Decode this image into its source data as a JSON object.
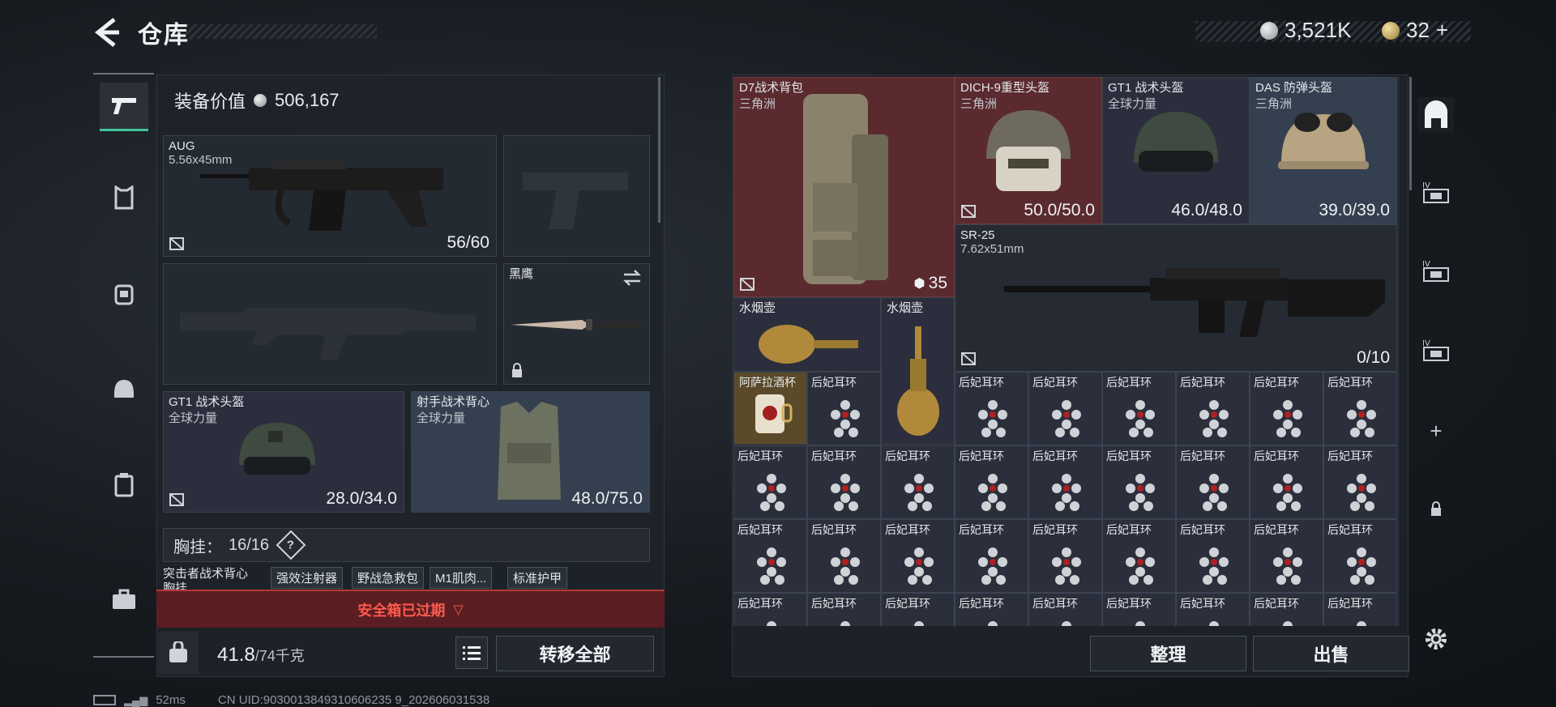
{
  "header": {
    "title": "仓库"
  },
  "currency": {
    "silver": "3,521K",
    "gold": "32",
    "gold_plus": "+"
  },
  "equipment": {
    "value_label": "装备价值",
    "value": "506,167",
    "primary": {
      "name": "AUG",
      "caliber": "5.56x45mm",
      "ammo": "56/60"
    },
    "melee": {
      "name": "黑鹰"
    },
    "helmet": {
      "name": "GT1 战术头盔",
      "brand": "全球力量",
      "durability": "28.0/34.0"
    },
    "armor": {
      "name": "射手战术背心",
      "brand": "全球力量",
      "durability": "48.0/75.0"
    },
    "chest_rig": {
      "label": "胸挂：",
      "capacity": "16/16",
      "help": "?"
    },
    "rig_items": [
      "突击者战术背心",
      "强效注射器",
      "野战急救包",
      "M1肌肉...",
      "标准护甲"
    ],
    "rig_item_second_line": "胸挂",
    "safebox_status": "安全箱已过期",
    "weight": "41.8",
    "weight_max": "/74千克",
    "transfer_all": "转移全部"
  },
  "stash": {
    "backpack": {
      "name": "D7战术背包",
      "brand": "三角洲",
      "count": "35"
    },
    "helmet1": {
      "name": "DICH-9重型头盔",
      "brand": "三角洲",
      "durability": "50.0/50.0"
    },
    "helmet2": {
      "name": "GT1 战术头盔",
      "brand": "全球力量",
      "durability": "46.0/48.0"
    },
    "helmet3": {
      "name": "DAS 防弹头盔",
      "brand": "三角洲",
      "durability": "39.0/39.0"
    },
    "rifle": {
      "name": "SR-25",
      "caliber": "7.62x51mm",
      "ammo": "0/10"
    },
    "hookah1": "水烟壶",
    "hookah2": "水烟壶",
    "cup": "阿萨拉酒杯",
    "earring": "后妃耳环",
    "sort": "整理",
    "sell": "出售"
  },
  "status": {
    "ping": "52ms",
    "uid": "CN UID:9030013849310606235 9_202606031538"
  },
  "colors": {
    "accent": "#44c29a",
    "warning": "#e0403a",
    "cell_red": "#5a2a2e",
    "cell_blue": "#34404f"
  }
}
